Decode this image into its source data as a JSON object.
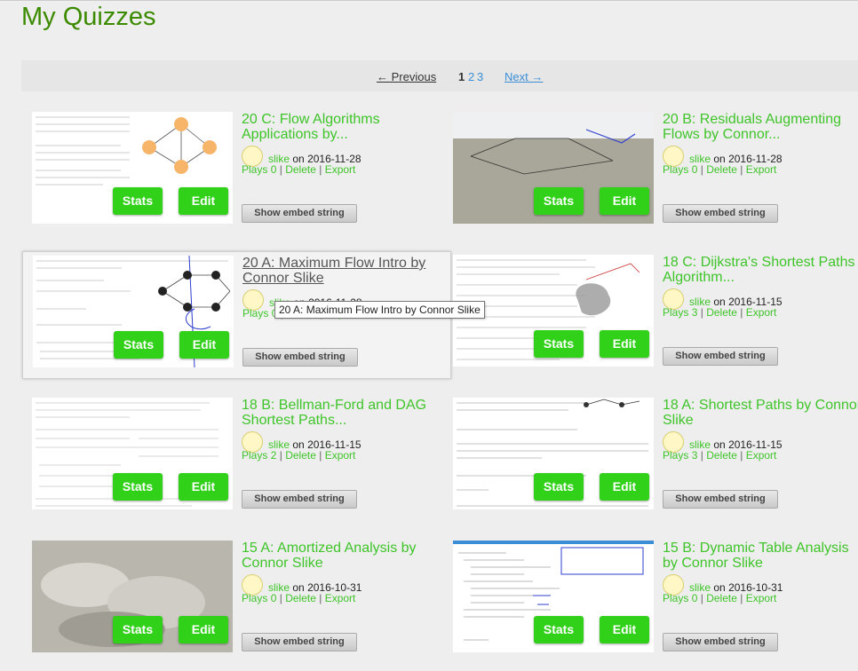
{
  "page": {
    "title": "My Quizzes"
  },
  "pager": {
    "previous": "← Previous",
    "pages": [
      "1",
      "2",
      "3"
    ],
    "next": "Next →"
  },
  "tooltip": "20 A: Maximum Flow Intro by Connor Slike",
  "common": {
    "stats_label": "Stats",
    "edit_label": "Edit",
    "embed_label": "Show embed string",
    "user": "slike",
    "on_label": "on",
    "plays_label": "Plays",
    "delete_label": "Delete",
    "export_label": "Export",
    "sep": "|"
  },
  "quizzes": [
    {
      "title": "20 C: Flow Algorithms Applications by...",
      "date": "2016-11-28",
      "plays": "0"
    },
    {
      "title": "20 B: Residuals Augmenting Flows by Connor...",
      "date": "2016-11-28",
      "plays": "0"
    },
    {
      "title": "20 A: Maximum Flow Intro by Connor Slike",
      "date": "2016-11-28",
      "plays": "0"
    },
    {
      "title": "18 C: Dijkstra's Shortest Paths Algorithm...",
      "date": "2016-11-15",
      "plays": "3"
    },
    {
      "title": "18 B: Bellman-Ford and DAG Shortest Paths...",
      "date": "2016-11-15",
      "plays": "2"
    },
    {
      "title": "18 A: Shortest Paths by Connor Slike",
      "date": "2016-11-15",
      "plays": "3"
    },
    {
      "title": "15 A: Amortized Analysis by Connor Slike",
      "date": "2016-10-31",
      "plays": "0"
    },
    {
      "title": "15 B: Dynamic Table Analysis by Connor Slike",
      "date": "2016-10-31",
      "plays": "0"
    }
  ],
  "colors": {
    "accent": "#3fc42a",
    "button": "#31d11a",
    "title": "#3b8a00"
  }
}
